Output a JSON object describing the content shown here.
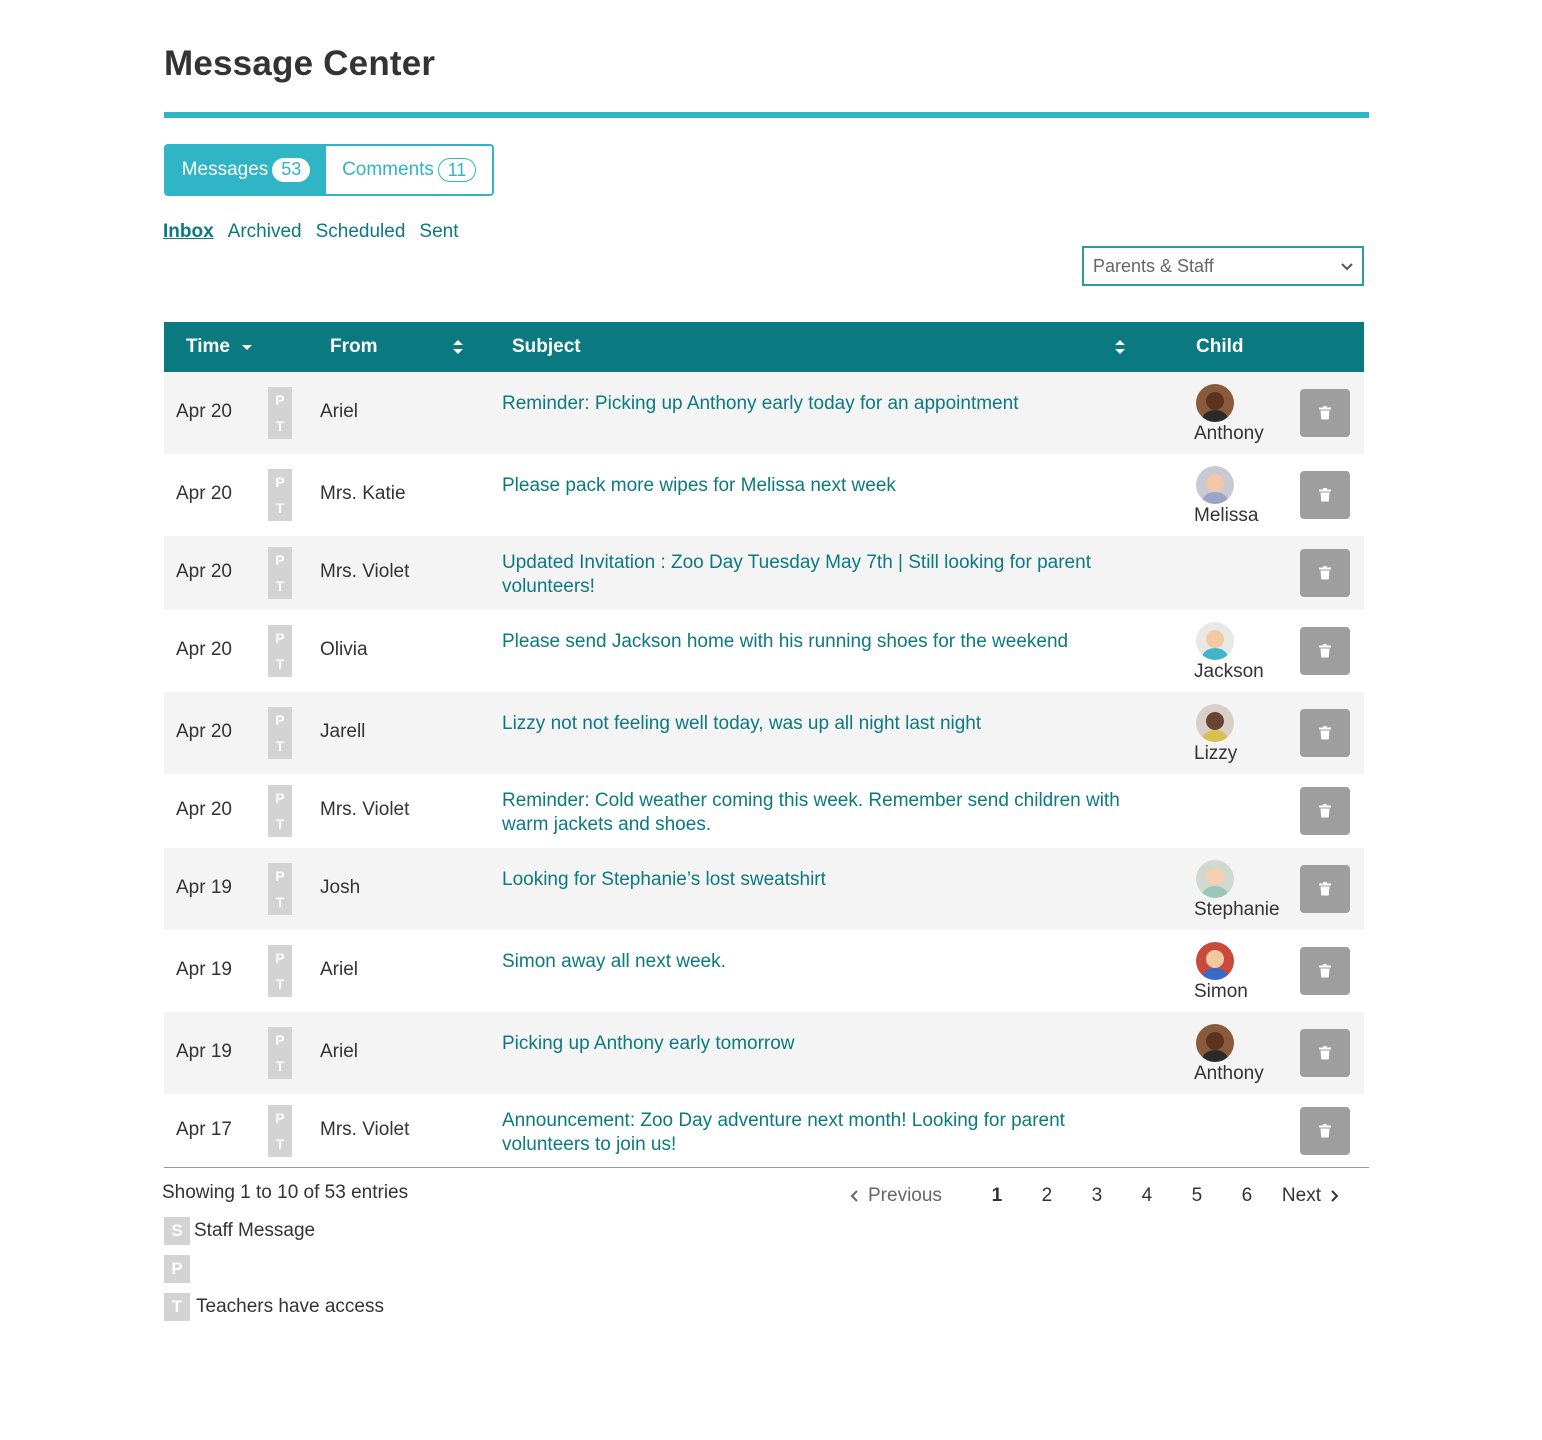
{
  "page": {
    "title": "Message Center"
  },
  "tabs": [
    {
      "label": "Messages",
      "count": "53",
      "active": true
    },
    {
      "label": "Comments",
      "count": "11",
      "active": false
    }
  ],
  "subnav": [
    {
      "label": "Inbox",
      "current": true
    },
    {
      "label": "Archived",
      "current": false
    },
    {
      "label": "Scheduled",
      "current": false
    },
    {
      "label": "Sent",
      "current": false
    }
  ],
  "filter": {
    "selected": "Parents & Staff"
  },
  "table": {
    "headers": {
      "time": "Time",
      "from": "From",
      "subject": "Subject",
      "child": "Child"
    },
    "badge_p": "P",
    "badge_t": "T",
    "rows": [
      {
        "time": "Apr 20",
        "from": "Ariel",
        "subject": "Reminder: Picking up Anthony early today for an appointment",
        "child": "Anthony",
        "avatar": "anthony"
      },
      {
        "time": "Apr 20",
        "from": "Mrs. Katie",
        "subject": "Please pack more wipes for Melissa next week",
        "child": "Melissa",
        "avatar": "melissa"
      },
      {
        "time": "Apr 20",
        "from": "Mrs. Violet",
        "subject": "Updated Invitation : Zoo Day Tuesday May 7th | Still looking for parent volunteers!",
        "child": "",
        "avatar": ""
      },
      {
        "time": "Apr 20",
        "from": "Olivia",
        "subject": "Please send Jackson home with his running shoes for the weekend",
        "child": "Jackson",
        "avatar": "jackson"
      },
      {
        "time": "Apr 20",
        "from": "Jarell",
        "subject": "Lizzy not not feeling well today, was up all night last night",
        "child": "Lizzy",
        "avatar": "lizzy"
      },
      {
        "time": "Apr 20",
        "from": "Mrs. Violet",
        "subject": "Reminder: Cold weather coming this week. Remember send children with warm jackets and shoes.",
        "child": "",
        "avatar": ""
      },
      {
        "time": "Apr 19",
        "from": "Josh",
        "subject": "Looking for Stephanie’s lost sweatshirt",
        "child": "Stephanie",
        "avatar": "stephanie"
      },
      {
        "time": "Apr 19",
        "from": "Ariel",
        "subject": "Simon away all next week.",
        "child": "Simon",
        "avatar": "simon"
      },
      {
        "time": "Apr 19",
        "from": "Ariel",
        "subject": "Picking up Anthony early tomorrow",
        "child": "Anthony",
        "avatar": "anthony"
      },
      {
        "time": "Apr 17",
        "from": "Mrs. Violet",
        "subject": "Announcement: Zoo Day adventure next month! Looking for parent volunteers to join us!",
        "child": "",
        "avatar": ""
      }
    ]
  },
  "footer": {
    "info": "Showing 1 to 10 of 53 entries",
    "previous": "Previous",
    "next": "Next",
    "pages": [
      "1",
      "2",
      "3",
      "4",
      "5",
      "6"
    ],
    "current_page": "1"
  },
  "legend": [
    {
      "badge": "S",
      "text": "Staff Message"
    },
    {
      "badge": "P",
      "text": ""
    },
    {
      "badge": "T",
      "text": "Teachers have access"
    }
  ],
  "colors": {
    "accent": "#2fb5c5",
    "header": "#0b7a80",
    "link": "#0b7a80",
    "delete": "#9e9e9e",
    "badge": "#d3d3d3"
  },
  "icons": {
    "sort": "sort-arrows-icon",
    "sort_desc": "caret-down-icon",
    "delete": "trash-icon",
    "select": "chevron-down-icon"
  }
}
